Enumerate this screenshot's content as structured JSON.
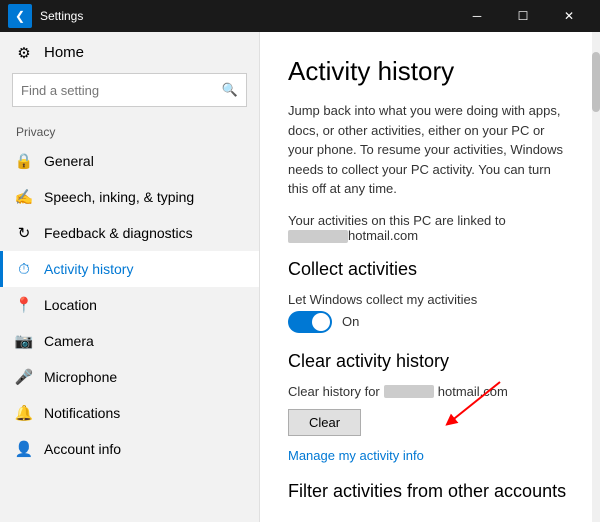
{
  "titleBar": {
    "backIcon": "❮",
    "title": "Settings",
    "minimizeIcon": "─",
    "maximizeIcon": "☐",
    "closeIcon": "✕"
  },
  "sidebar": {
    "homeLabel": "Home",
    "homeIcon": "⚙",
    "searchPlaceholder": "Find a setting",
    "searchIcon": "🔍",
    "sectionLabel": "Privacy",
    "navItems": [
      {
        "id": "general",
        "icon": "🔒",
        "label": "General",
        "active": false
      },
      {
        "id": "speech",
        "icon": "✍",
        "label": "Speech, inking, & typing",
        "active": false
      },
      {
        "id": "feedback",
        "icon": "↻",
        "label": "Feedback & diagnostics",
        "active": false
      },
      {
        "id": "activity",
        "icon": "⏱",
        "label": "Activity history",
        "active": true
      },
      {
        "id": "location",
        "icon": "📍",
        "label": "Location",
        "active": false
      },
      {
        "id": "camera",
        "icon": "📷",
        "label": "Camera",
        "active": false
      },
      {
        "id": "microphone",
        "icon": "🎤",
        "label": "Microphone",
        "active": false
      },
      {
        "id": "notifications",
        "icon": "🔔",
        "label": "Notifications",
        "active": false
      },
      {
        "id": "account",
        "icon": "👤",
        "label": "Account info",
        "active": false
      }
    ]
  },
  "content": {
    "pageTitle": "Activity history",
    "description": "Jump back into what you were doing with apps, docs, or other activities, either on your PC or your phone. To resume your activities, Windows needs to collect your PC activity. You can turn this off at any time.",
    "linkedAccountPrefix": "Your activities on this PC are linked to",
    "linkedAccountRedacted": "           ",
    "linkedAccountSuffix": "hotmail.com",
    "collectSection": {
      "heading": "Collect activities",
      "toggleLabel": "Let Windows collect my activities",
      "toggleState": "On"
    },
    "clearSection": {
      "heading": "Clear activity history",
      "clearForLabel": "Clear history for",
      "clearForRedacted": "       ",
      "clearForSuffix": "hotmail.com",
      "clearButton": "Clear",
      "manageLink": "Manage my activity info"
    },
    "filterSection": {
      "heading": "Filter activities from other accounts"
    }
  }
}
